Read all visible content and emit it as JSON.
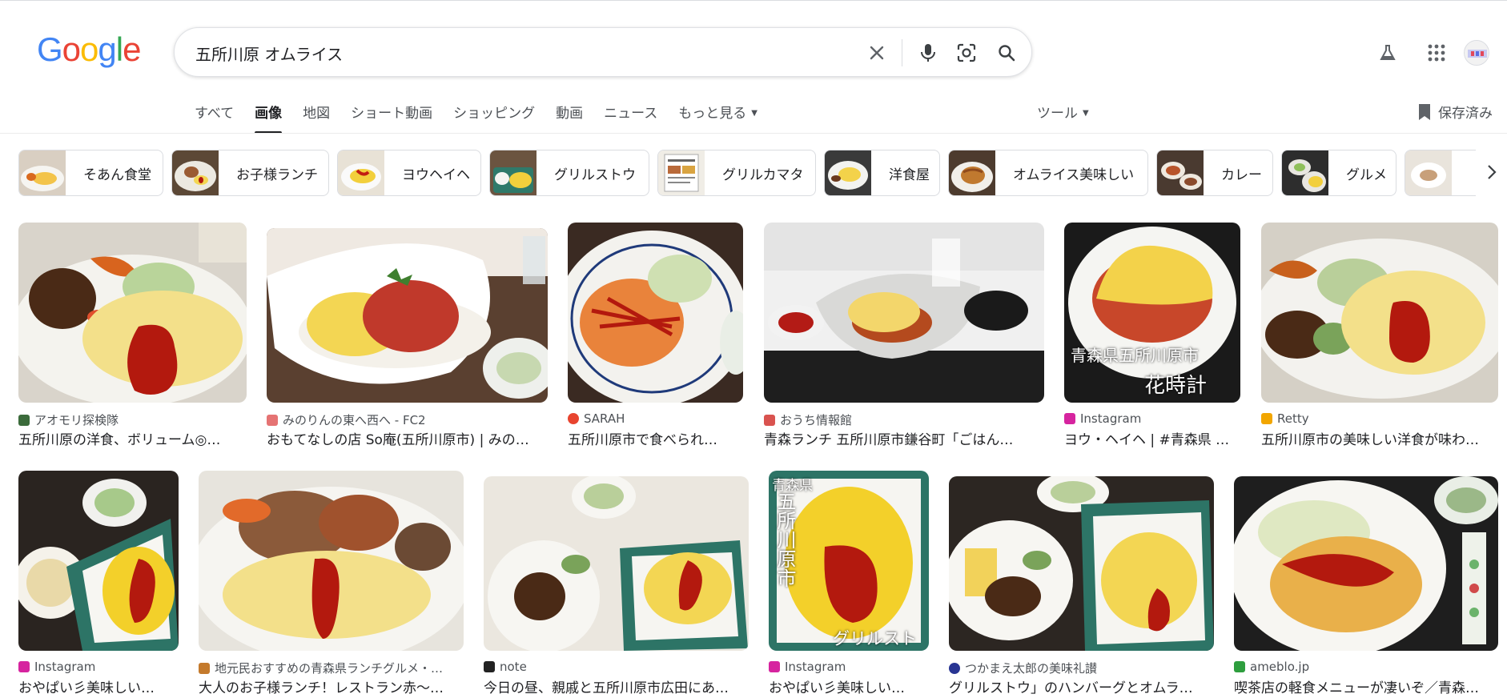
{
  "search": {
    "query": "五所川原 オムライス"
  },
  "tabs": [
    {
      "label": "すべて"
    },
    {
      "label": "画像"
    },
    {
      "label": "地図"
    },
    {
      "label": "ショート動画"
    },
    {
      "label": "ショッピング"
    },
    {
      "label": "動画"
    },
    {
      "label": "ニュース"
    },
    {
      "label": "もっと見る"
    }
  ],
  "tools_label": "ツール",
  "saved_label": "保存済み",
  "chips": [
    {
      "label": "そあん食堂"
    },
    {
      "label": "お子様ランチ"
    },
    {
      "label": "ヨウヘイヘ"
    },
    {
      "label": "グリルストウ"
    },
    {
      "label": "グリルカマタ"
    },
    {
      "label": "洋食屋"
    },
    {
      "label": "オムライス美味しい"
    },
    {
      "label": "カレー"
    },
    {
      "label": "グルメ"
    }
  ],
  "results": [
    {
      "source": "アオモリ探検隊",
      "title": "五所川原の洋食、ボリューム◎…"
    },
    {
      "source": "みのりんの東へ西へ - FC2",
      "title": "おもてなしの店 So庵(五所川原市) | みの…"
    },
    {
      "source": "SARAH",
      "title": "五所川原市で食べられ…"
    },
    {
      "source": "おうち情報館",
      "title": "青森ランチ 五所川原市鎌谷町「ごはん…"
    },
    {
      "source": "Instagram",
      "title": "ヨウ・ヘイヘ | #青森県 …",
      "overlay_top": "青森県五所川原市",
      "overlay_bottom": "花時計"
    },
    {
      "source": "Retty",
      "title": "五所川原市の美味しい洋食が味わ…"
    },
    {
      "source": "Instagram",
      "title": "おやぱい彡美味しい…"
    },
    {
      "source": "地元民おすすめの青森県ランチグルメ・…",
      "title": "大人のお子様ランチ！レストラン赤〜…"
    },
    {
      "source": "note",
      "title": "今日の昼、親戚と五所川原市広田にあ…"
    },
    {
      "source": "Instagram",
      "title": "おやぱい彡美味しい…",
      "overlay_top": "青森県",
      "overlay_side": "五所川原市",
      "overlay_bottom": "グリルスト"
    },
    {
      "source": "つかまえ太郎の美味礼讃",
      "title": "グリルストウ」のハンバーグとオムラ…"
    },
    {
      "source": "ameblo.jp",
      "title": "喫茶店の軽食メニューが凄いぞ／青森…"
    }
  ],
  "colors": {
    "google_blue": "#4285F4",
    "google_red": "#EA4335",
    "google_yellow": "#FBBC05",
    "google_green": "#34A853",
    "omelette": "#f3d653",
    "ketchup": "#b3190e",
    "plate": "#f4f4f0"
  }
}
